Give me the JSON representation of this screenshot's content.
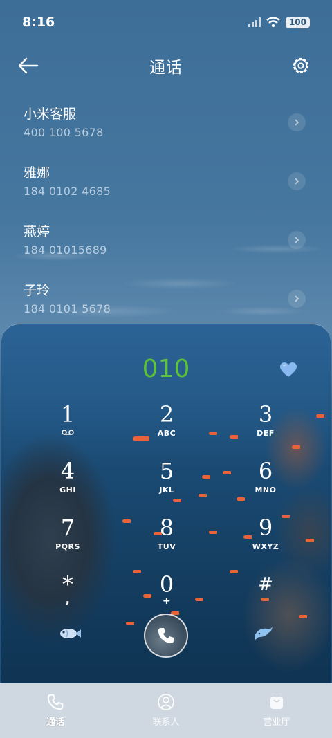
{
  "status_bar": {
    "time": "8:16",
    "battery": "100"
  },
  "header": {
    "title": "通话"
  },
  "contacts": [
    {
      "name": "小米客服",
      "phone": "400 100 5678"
    },
    {
      "name": "雅娜",
      "phone": "184 0102 4685"
    },
    {
      "name": "燕婷",
      "phone": "184 01015689"
    },
    {
      "name": "子玲",
      "phone": "184 0101 5678"
    }
  ],
  "dialer": {
    "display": "010",
    "keys": [
      {
        "digit": "1",
        "letters": ""
      },
      {
        "digit": "2",
        "letters": "ABC"
      },
      {
        "digit": "3",
        "letters": "DEF"
      },
      {
        "digit": "4",
        "letters": "GHI"
      },
      {
        "digit": "5",
        "letters": "JKL"
      },
      {
        "digit": "6",
        "letters": "MNO"
      },
      {
        "digit": "7",
        "letters": "PQRS"
      },
      {
        "digit": "8",
        "letters": "TUV"
      },
      {
        "digit": "9",
        "letters": "WXYZ"
      },
      {
        "digit": "*",
        "letters": ","
      },
      {
        "digit": "0",
        "letters": "+"
      },
      {
        "digit": "#",
        "letters": ""
      }
    ]
  },
  "tabs": [
    {
      "label": "通话",
      "icon": "phone-icon",
      "active": true
    },
    {
      "label": "联系人",
      "icon": "person-icon",
      "active": false
    },
    {
      "label": "营业厅",
      "icon": "store-bag-icon",
      "active": false
    }
  ],
  "colors": {
    "dial_text": "#5cc33a",
    "heart": "#8ab8f0"
  }
}
